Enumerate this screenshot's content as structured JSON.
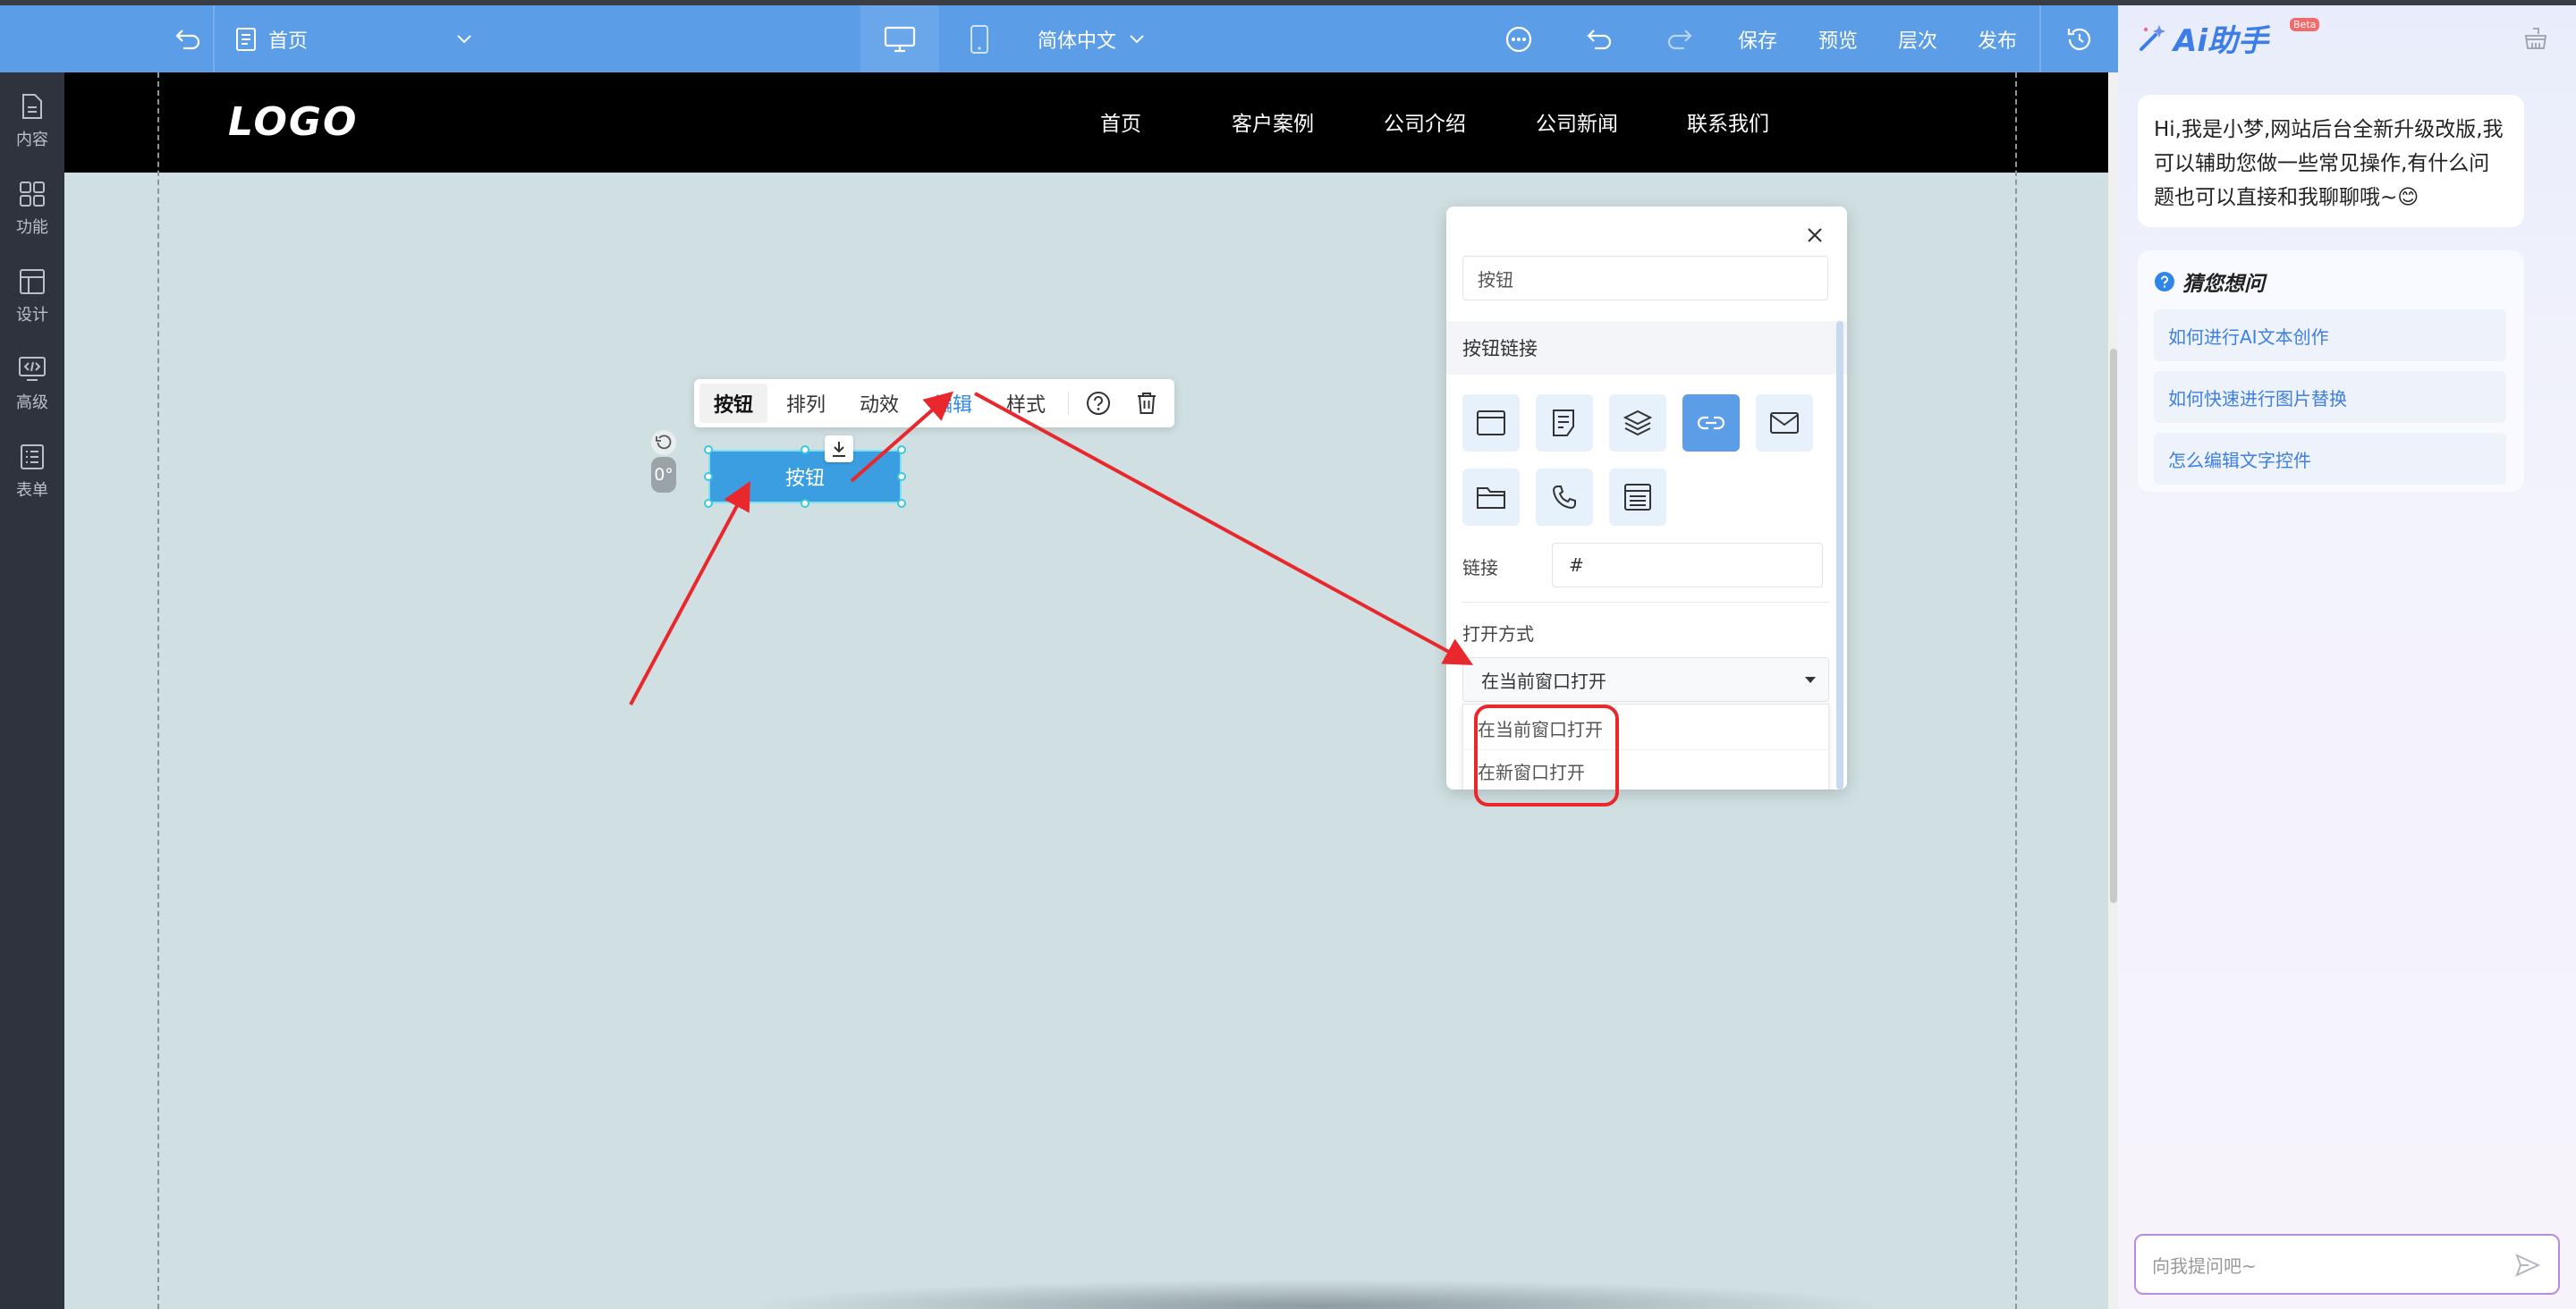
{
  "topbar": {
    "page_label": "首页",
    "language": "简体中文",
    "save": "保存",
    "preview": "预览",
    "layers": "层次",
    "publish": "发布"
  },
  "sidebar": {
    "items": [
      {
        "label": "内容",
        "icon": "document-icon"
      },
      {
        "label": "功能",
        "icon": "grid-icon"
      },
      {
        "label": "设计",
        "icon": "layout-icon"
      },
      {
        "label": "高级",
        "icon": "code-icon"
      },
      {
        "label": "表单",
        "icon": "form-icon"
      }
    ]
  },
  "site": {
    "logo": "LOGO",
    "nav": [
      "首页",
      "客户案例",
      "公司介绍",
      "公司新闻",
      "联系我们"
    ]
  },
  "element_toolbar": {
    "tabs": [
      "按钮",
      "排列",
      "动效",
      "编辑",
      "样式"
    ]
  },
  "button_element": {
    "label": "按钮",
    "rotation": "0°"
  },
  "link_panel": {
    "name_value": "按钮",
    "section_title": "按钮链接",
    "link_label": "链接",
    "link_value": "#",
    "open_label": "打开方式",
    "open_selected": "在当前窗口打开",
    "open_options": [
      "在当前窗口打开",
      "在新窗口打开"
    ]
  },
  "ai": {
    "title": "Ai助手",
    "beta": "Beta",
    "greeting": "Hi,我是小梦,网站后台全新升级改版,我可以辅助您做一些常见操作,有什么问题也可以直接和我聊聊哦~😊",
    "guess_title": "猜您想问",
    "questions": [
      "如何进行AI文本创作",
      "如何快速进行图片替换",
      "怎么编辑文字控件"
    ],
    "input_placeholder": "向我提问吧~"
  },
  "colors": {
    "topbar": "#5b9de7",
    "accent": "#2f86e8",
    "annotation": "#e8282d"
  }
}
